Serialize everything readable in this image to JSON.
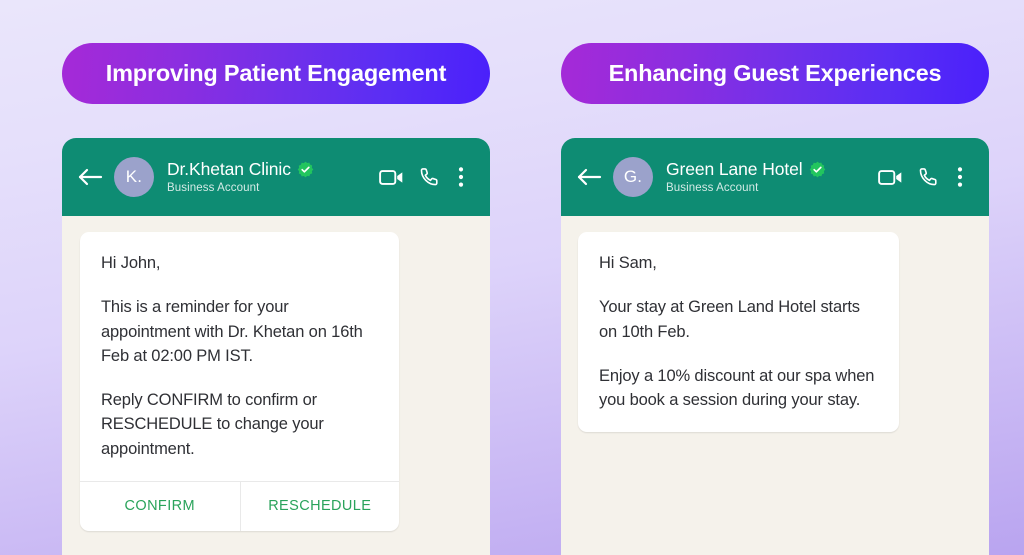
{
  "panels": [
    {
      "title": "Improving Patient Engagement",
      "header": {
        "back_icon": "arrow-left-icon",
        "avatar_initials": "K.",
        "name": "Dr.Khetan Clinic",
        "verified_icon": "verified-badge-icon",
        "subtitle": "Business Account",
        "video_icon": "video-camera-icon",
        "call_icon": "phone-icon",
        "menu_icon": "more-vertical-icon"
      },
      "message": {
        "paragraphs": [
          "Hi John,",
          "This is a reminder for your appointment with Dr. Khetan on 16th Feb at 02:00 PM IST.",
          "Reply CONFIRM to confirm or RESCHEDULE to change your appointment."
        ],
        "actions": [
          "CONFIRM",
          "RESCHEDULE"
        ]
      }
    },
    {
      "title": "Enhancing Guest Experiences",
      "header": {
        "back_icon": "arrow-left-icon",
        "avatar_initials": "G.",
        "name": "Green Lane Hotel",
        "verified_icon": "verified-badge-icon",
        "subtitle": "Business Account",
        "video_icon": "video-camera-icon",
        "call_icon": "phone-icon",
        "menu_icon": "more-vertical-icon"
      },
      "message": {
        "paragraphs": [
          "Hi Sam,",
          "Your stay at Green Land Hotel starts on 10th Feb.",
          "Enjoy a 10% discount at our spa when you book a session during your stay."
        ],
        "actions": []
      }
    }
  ],
  "colors": {
    "header_green": "#0e8c73",
    "action_green": "#2aa35b",
    "verified_green": "#22c55e",
    "avatar_lavender": "#9ba2cb",
    "pill_gradient_start": "#a32ad8",
    "pill_gradient_end": "#4a20fb",
    "phone_bg": "#f5f2eb"
  }
}
